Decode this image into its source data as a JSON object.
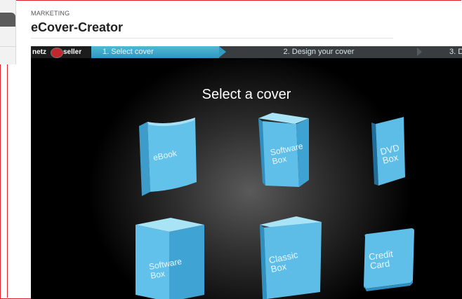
{
  "header": {
    "section": "MARKETING",
    "title": "eCover-Creator"
  },
  "app": {
    "logo": {
      "left": "netz",
      "right": "seller"
    },
    "steps": [
      {
        "label": "1. Select cover"
      },
      {
        "label": "2. Design your cover"
      },
      {
        "label": "3. D"
      }
    ],
    "stage_title": "Select a cover",
    "covers": [
      {
        "line1": "eBook",
        "line2": ""
      },
      {
        "line1": "Software",
        "line2": "Box"
      },
      {
        "line1": "DVD",
        "line2": "Box"
      },
      {
        "line1": "Software",
        "line2": "Box"
      },
      {
        "line1": "Classic",
        "line2": "Box"
      },
      {
        "line1": "Credit",
        "line2": "Card"
      }
    ],
    "colors": {
      "cover_light": "#8fd6f2",
      "cover_mid": "#56b9e3",
      "cover_dark": "#2f8fbf",
      "step_active": "#3aa6cf"
    }
  }
}
